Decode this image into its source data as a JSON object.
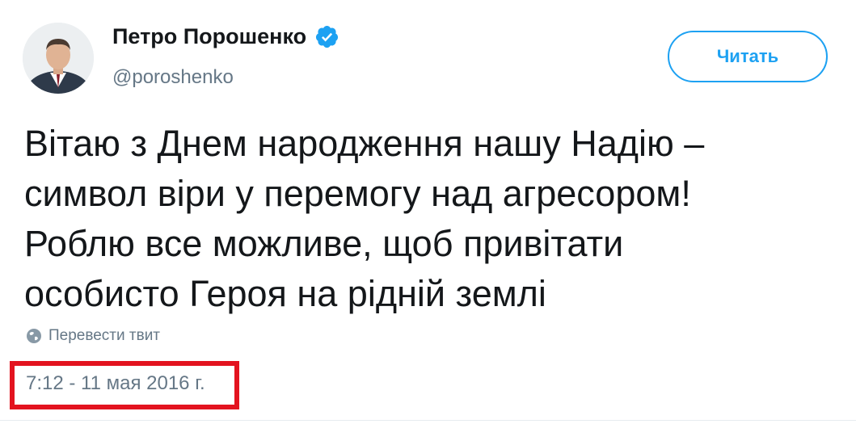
{
  "tweet": {
    "author_name": "Петро Порошенко",
    "author_handle": "@poroshenko",
    "follow_label": "Читать",
    "text_lines": [
      "Вітаю з Днем народження нашу Надію –",
      "символ віри у перемогу над агресором!",
      "Роблю все можливе, щоб привітати",
      "особисто Героя на рідній землі"
    ],
    "translate_label": "Перевести твит",
    "timestamp": "7:12 - 11 мая 2016 г."
  },
  "icons": {
    "verified": "verified-badge-icon",
    "translate": "globe-icon"
  },
  "colors": {
    "accent": "#1da1f2",
    "text": "#14171a",
    "secondary_text": "#657786",
    "highlight": "#e3131f"
  }
}
